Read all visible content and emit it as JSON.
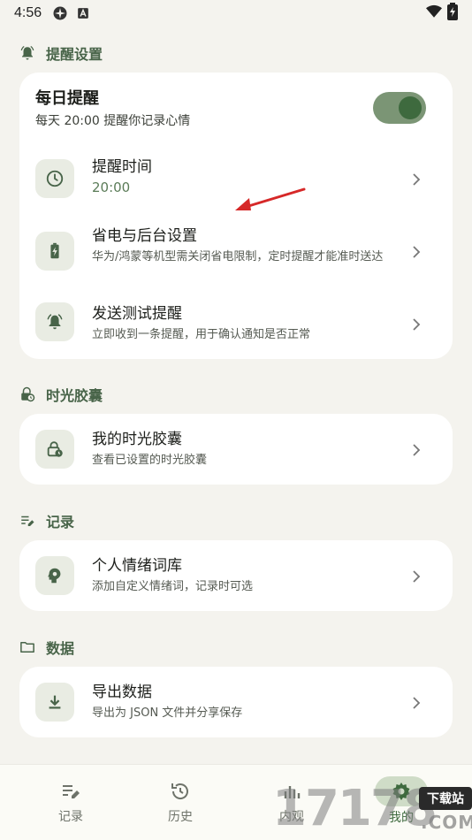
{
  "status_bar": {
    "time": "4:56",
    "icons": [
      "app-icon-1",
      "app-icon-2"
    ],
    "right_icons": [
      "wifi-icon",
      "battery-charging-icon"
    ]
  },
  "sections": {
    "reminder": {
      "header": "提醒设置",
      "header_icon": "bell-ring-icon",
      "daily": {
        "title": "每日提醒",
        "subtitle": "每天 20:00 提醒你记录心情",
        "enabled": true
      },
      "rows": [
        {
          "title": "提醒时间",
          "subtitle": "20:00",
          "icon": "clock-icon"
        },
        {
          "title": "省电与后台设置",
          "subtitle": "华为/鸿蒙等机型需关闭省电限制，定时提醒才能准时送达",
          "icon": "battery-icon"
        },
        {
          "title": "发送测试提醒",
          "subtitle": "立即收到一条提醒，用于确认通知是否正常",
          "icon": "bell-ring-icon"
        }
      ]
    },
    "capsule": {
      "header": "时光胶囊",
      "header_icon": "lock-clock-icon",
      "rows": [
        {
          "title": "我的时光胶囊",
          "subtitle": "查看已设置的时光胶囊",
          "icon": "lock-clock-icon"
        }
      ]
    },
    "records": {
      "header": "记录",
      "header_icon": "edit-note-icon",
      "rows": [
        {
          "title": "个人情绪词库",
          "subtitle": "添加自定义情绪词，记录时可选",
          "icon": "psychology-icon"
        }
      ]
    },
    "data": {
      "header": "数据",
      "header_icon": "folder-icon",
      "rows": [
        {
          "title": "导出数据",
          "subtitle": "导出为 JSON 文件并分享保存",
          "icon": "download-icon"
        }
      ]
    }
  },
  "bottom_nav": {
    "items": [
      {
        "label": "记录",
        "icon": "edit-note-icon"
      },
      {
        "label": "历史",
        "icon": "history-icon"
      },
      {
        "label": "内观",
        "icon": "insights-icon"
      },
      {
        "label": "我的",
        "icon": "gear-icon",
        "active": true
      }
    ]
  },
  "watermark": {
    "digits": "17178",
    "badge": "下载站",
    "suffix": ".COM"
  },
  "colors": {
    "background": "#f4f3ee",
    "card": "#ffffff",
    "accent": "#486449",
    "icon_box": "#e9ece3",
    "toggle_track": "#7b9575",
    "toggle_knob": "#3e6a3e",
    "annotation_arrow": "#d62828"
  }
}
